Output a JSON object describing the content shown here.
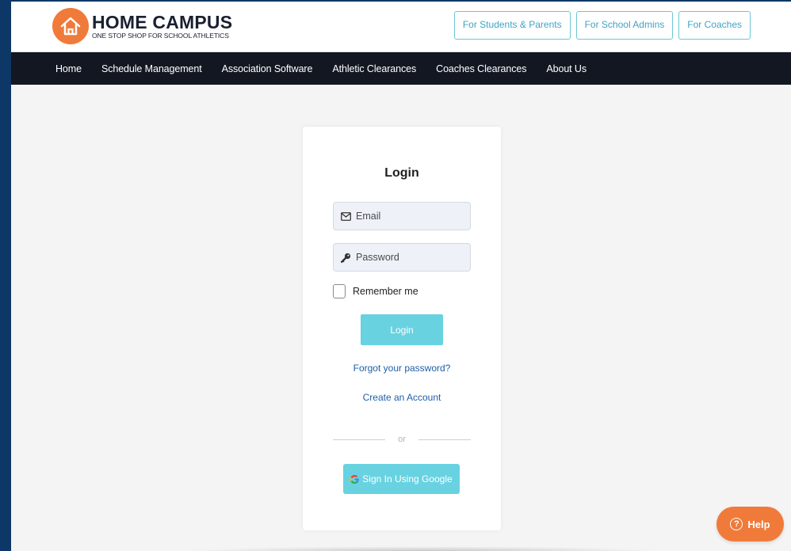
{
  "brand": {
    "title": "HOME CAMPUS",
    "tagline": "ONE STOP SHOP FOR SCHOOL ATHLETICS",
    "logo_icon": "house-icon",
    "accent": "#f07a3a"
  },
  "top_buttons": [
    {
      "label": "For Students & Parents"
    },
    {
      "label": "For School Admins"
    },
    {
      "label": "For Coaches"
    }
  ],
  "nav": [
    {
      "label": "Home"
    },
    {
      "label": "Schedule Management"
    },
    {
      "label": "Association Software"
    },
    {
      "label": "Athletic Clearances"
    },
    {
      "label": "Coaches Clearances"
    },
    {
      "label": "About Us"
    }
  ],
  "login": {
    "title": "Login",
    "email_placeholder": "Email",
    "email_icon": "envelope-icon",
    "password_placeholder": "Password",
    "password_icon": "key-icon",
    "remember_label": "Remember me",
    "remember_checked": false,
    "submit_label": "Login",
    "forgot_label": "Forgot your password?",
    "create_label": "Create an Account",
    "divider_label": "or",
    "google_label": "Sign In Using Google",
    "google_icon": "google-icon",
    "button_color": "#68d2e1",
    "link_color": "#1e5fa8"
  },
  "help": {
    "label": "Help",
    "icon": "question-circle-icon"
  }
}
